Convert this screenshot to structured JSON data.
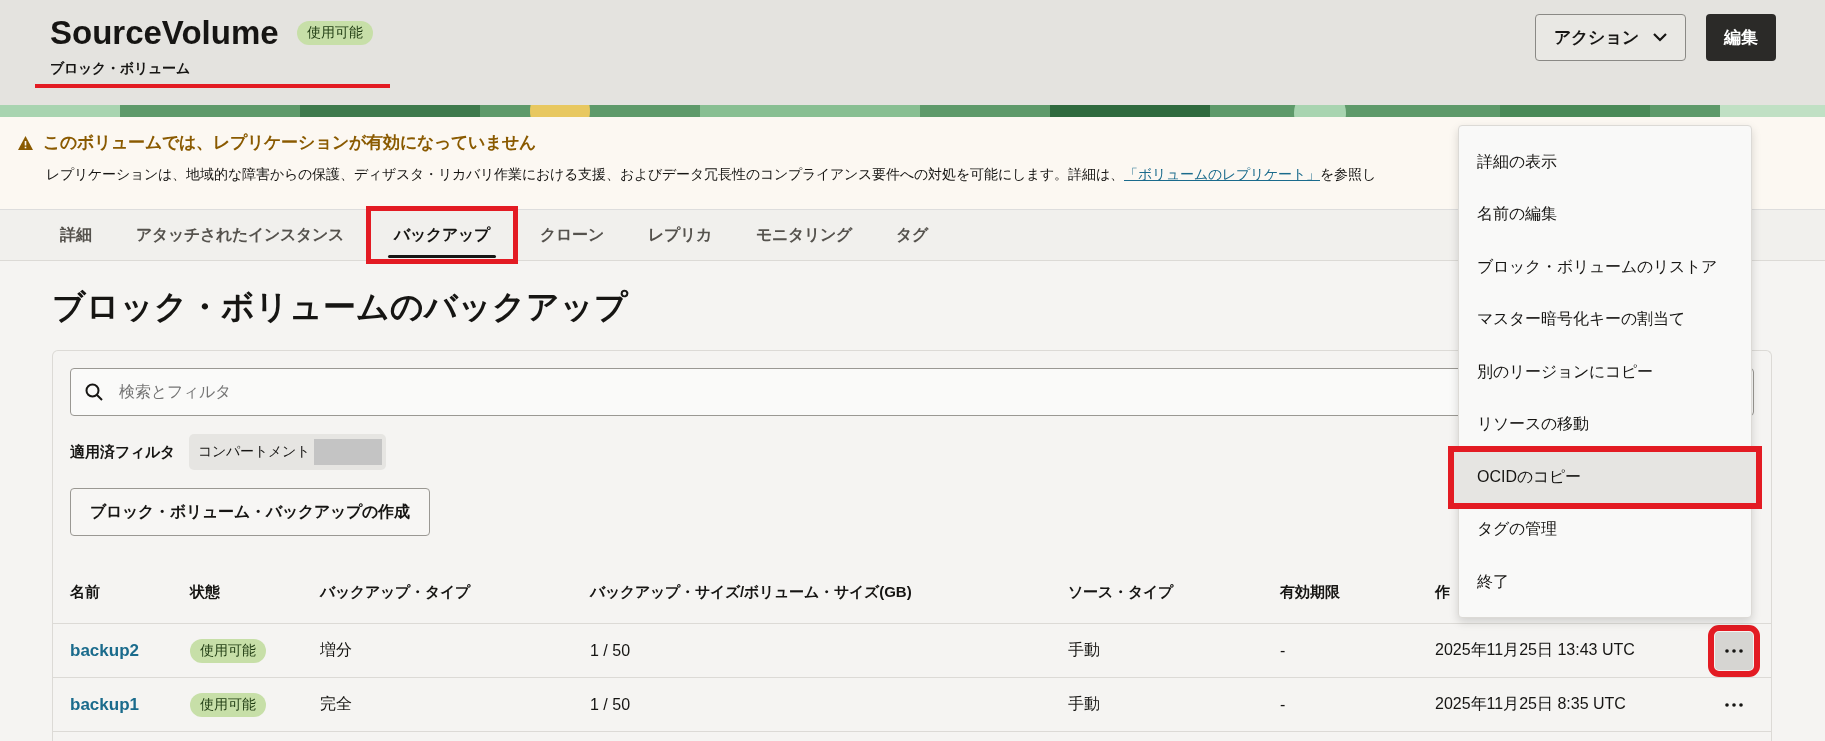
{
  "header": {
    "title": "SourceVolume",
    "status": "使用可能",
    "subtitle": "ブロック・ボリューム",
    "subtitle_underlined": true,
    "actions_button": "アクション",
    "edit_button": "編集"
  },
  "warning": {
    "title": "このボリュームでは、レプリケーションが有効になっていません",
    "text": "レプリケーションは、地域的な障害からの保護、ディザスタ・リカバリ作業における支援、およびデータ冗長性のコンプライアンス要件への対処を可能にします。詳細は、",
    "link": "「ボリュームのレプリケート」",
    "text_after": "を参照し"
  },
  "tabs": [
    {
      "label": "詳細",
      "selected": false,
      "highlighted": false
    },
    {
      "label": "アタッチされたインスタンス",
      "selected": false,
      "highlighted": false
    },
    {
      "label": "バックアップ",
      "selected": true,
      "highlighted": true
    },
    {
      "label": "クローン",
      "selected": false,
      "highlighted": false
    },
    {
      "label": "レプリカ",
      "selected": false,
      "highlighted": false
    },
    {
      "label": "モニタリング",
      "selected": false,
      "highlighted": false
    },
    {
      "label": "タグ",
      "selected": false,
      "highlighted": false
    }
  ],
  "section_title": "ブロック・ボリュームのバックアップ",
  "search": {
    "placeholder": "検索とフィルタ"
  },
  "applied_filters": {
    "label": "適用済フィルタ",
    "chip": "コンパートメント"
  },
  "create_button": "ブロック・ボリューム・バックアップの作成",
  "table": {
    "columns": [
      "名前",
      "状態",
      "バックアップ・タイプ",
      "バックアップ・サイズ/ボリューム・サイズ(GB)",
      "ソース・タイプ",
      "有効期限",
      "作"
    ],
    "rows": [
      {
        "name": "backup2",
        "status": "使用可能",
        "type": "増分",
        "size": "1 / 50",
        "source": "手動",
        "expires": "-",
        "created": "2025年11月25日 13:43 UTC",
        "menu_open": true,
        "highlighted": true
      },
      {
        "name": "backup1",
        "status": "使用可能",
        "type": "完全",
        "size": "1 / 50",
        "source": "手動",
        "expires": "-",
        "created": "2025年11月25日 8:35 UTC",
        "menu_open": false,
        "highlighted": false
      }
    ]
  },
  "menu": {
    "items": [
      {
        "label": "詳細の表示",
        "selected": false,
        "highlighted": false
      },
      {
        "label": "名前の編集",
        "selected": false,
        "highlighted": false
      },
      {
        "label": "ブロック・ボリュームのリストア",
        "selected": false,
        "highlighted": false
      },
      {
        "label": "マスター暗号化キーの割当て",
        "selected": false,
        "highlighted": false
      },
      {
        "label": "別のリージョンにコピー",
        "selected": false,
        "highlighted": false
      },
      {
        "label": "リソースの移動",
        "selected": false,
        "highlighted": false
      },
      {
        "label": "OCIDのコピー",
        "selected": true,
        "highlighted": true
      },
      {
        "label": "タグの管理",
        "selected": false,
        "highlighted": false
      },
      {
        "label": "終了",
        "selected": false,
        "highlighted": false
      }
    ]
  }
}
